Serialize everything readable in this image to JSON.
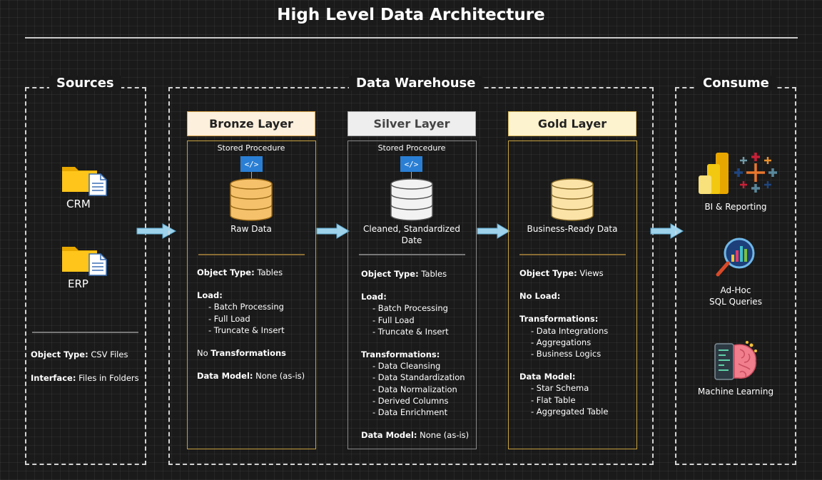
{
  "title": "High Level Data Architecture",
  "sources": {
    "label": "Sources",
    "items": [
      {
        "label": "CRM",
        "icon": "folder-file-icon"
      },
      {
        "label": "ERP",
        "icon": "folder-file-icon"
      }
    ],
    "object_type_label": "Object Type:",
    "object_type_value": "CSV Files",
    "interface_label": "Interface:",
    "interface_value": "Files in Folders"
  },
  "warehouse": {
    "label": "Data Warehouse",
    "bronze": {
      "title": "Bronze Layer",
      "stored_procedure": "Stored Procedure",
      "caption": "Raw Data",
      "object_type_label": "Object Type:",
      "object_type_value": "Tables",
      "load_label": "Load:",
      "load_items": [
        "- Batch Processing",
        "- Full Load",
        "- Truncate & Insert"
      ],
      "transform_prefix": "No",
      "transform_label": "Transformations",
      "data_model_label": "Data Model:",
      "data_model_value": "None (as-is)"
    },
    "silver": {
      "title": "Silver Layer",
      "stored_procedure": "Stored Procedure",
      "caption_line1": "Cleaned, Standardized",
      "caption_line2": "Date",
      "object_type_label": "Object Type:",
      "object_type_value": "Tables",
      "load_label": "Load:",
      "load_items": [
        "- Batch Processing",
        "- Full Load",
        "- Truncate & Insert"
      ],
      "transform_label": "Transformations:",
      "transform_items": [
        "- Data Cleansing",
        "- Data Standardization",
        "- Data Normalization",
        "- Derived Columns",
        "- Data Enrichment"
      ],
      "data_model_label": "Data Model:",
      "data_model_value": "None (as-is)"
    },
    "gold": {
      "title": "Gold Layer",
      "caption": "Business-Ready Data",
      "object_type_label": "Object Type:",
      "object_type_value": "Views",
      "load_text": "No Load:",
      "transform_label": "Transformations:",
      "transform_items": [
        "- Data Integrations",
        "- Aggregations",
        "- Business Logics"
      ],
      "data_model_label": "Data Model:",
      "data_model_items": [
        "- Star Schema",
        "- Flat Table",
        "- Aggregated Table"
      ]
    }
  },
  "consume": {
    "label": "Consume",
    "bi": "BI & Reporting",
    "adhoc_line1": "Ad-Hoc",
    "adhoc_line2": "SQL Queries",
    "ml": "Machine Learning"
  },
  "colors": {
    "bronze_head": "#fdf0dc",
    "silver_head": "#eeeeee",
    "gold_head": "#fef3cf",
    "bronze_db": "#f5c26b",
    "silver_db": "#f2f2f2",
    "gold_db": "#fbe3a8",
    "arrow": "#9fd3ec",
    "layer_border": "#c8a23f"
  }
}
